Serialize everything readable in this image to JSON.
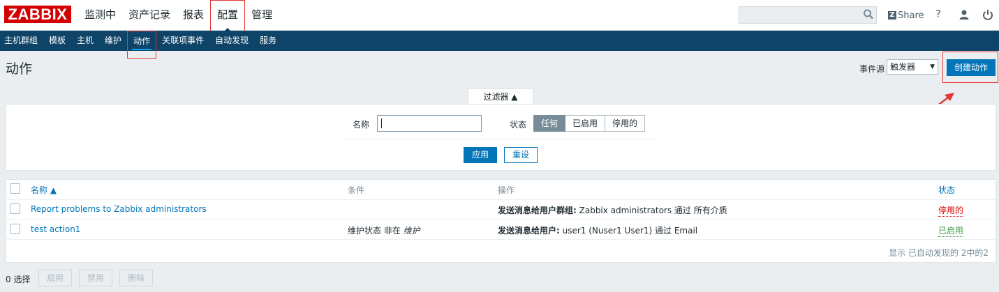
{
  "logo": "ZABBIX",
  "main_menu": [
    "监测中",
    "资产记录",
    "报表",
    "配置",
    "管理"
  ],
  "search": {
    "placeholder": ""
  },
  "header_links": {
    "share": "Share",
    "help": "?"
  },
  "sub_menu": [
    "主机群组",
    "模板",
    "主机",
    "维护",
    "动作",
    "关联项事件",
    "自动发现",
    "服务"
  ],
  "page": {
    "title": "动作",
    "event_source_label": "事件源",
    "event_source_value": "触发器",
    "create_button": "创建动作"
  },
  "filter": {
    "tab_label": "过滤器 ▲",
    "name_label": "名称",
    "name_value": "",
    "status_label": "状态",
    "status_options": [
      "任何",
      "已启用",
      "停用的"
    ],
    "status_selected": "任何",
    "apply_label": "应用",
    "reset_label": "重设"
  },
  "table": {
    "headers": {
      "name": "名称 ▲",
      "conditions": "条件",
      "operations": "操作",
      "status": "状态"
    },
    "rows": [
      {
        "name": "Report problems to Zabbix administrators",
        "conditions": "",
        "operation_bold": "发送消息给用户群组:",
        "operation_rest": " Zabbix administrators 通过 所有介质",
        "status": "停用的"
      },
      {
        "name": "test action1",
        "conditions_prefix": "维护状态 非在 ",
        "conditions_italic": "维护",
        "operation_bold": "发送消息给用户:",
        "operation_rest": " user1 (Nuser1 User1) 通过 Email",
        "status": "已启用"
      }
    ],
    "paging": "显示 已自动发现的 2中的2"
  },
  "footer": {
    "selected": "0 选择",
    "buttons": [
      "启用",
      "禁用",
      "删除"
    ]
  },
  "colors": {
    "brand": "#d40000",
    "nav": "#0e4468",
    "primary": "#0275b8",
    "annotation": "#e33734",
    "disabled_status": "#dc0000",
    "enabled_status": "#429e47"
  }
}
